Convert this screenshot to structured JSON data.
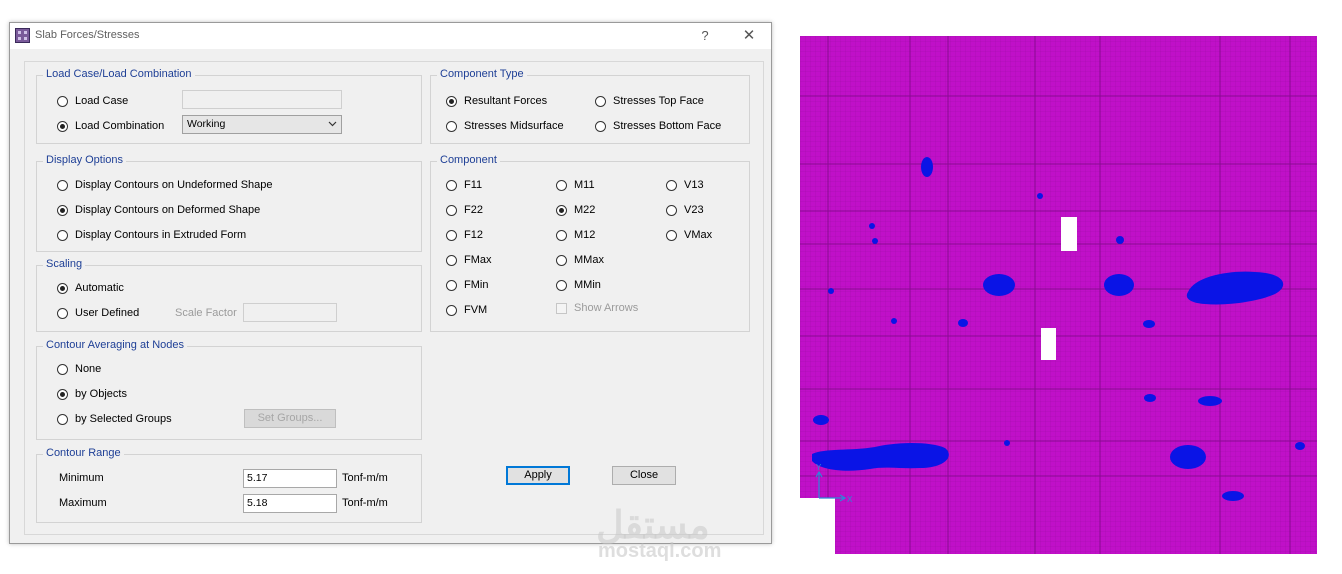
{
  "window": {
    "title": "Slab Forces/Stresses",
    "help": "?",
    "close": "✕"
  },
  "load_case_group": {
    "legend": "Load Case/Load Combination",
    "load_case_label": "Load Case",
    "load_case_value": "",
    "load_combination_label": "Load Combination",
    "load_combination_value": "Working",
    "selected": "Load Combination"
  },
  "display_options": {
    "legend": "Display Options",
    "options": [
      "Display Contours on Undeformed Shape",
      "Display Contours on Deformed Shape",
      "Display Contours in Extruded Form"
    ],
    "selected": "Display Contours on Deformed Shape"
  },
  "scaling": {
    "legend": "Scaling",
    "automatic_label": "Automatic",
    "user_defined_label": "User Defined",
    "scale_factor_label": "Scale Factor",
    "scale_factor_value": "",
    "selected": "Automatic"
  },
  "contour_averaging": {
    "legend": "Contour Averaging at Nodes",
    "options": [
      "None",
      "by Objects",
      "by Selected Groups"
    ],
    "selected": "by Objects",
    "set_groups_label": "Set Groups..."
  },
  "contour_range": {
    "legend": "Contour Range",
    "minimum_label": "Minimum",
    "minimum_value": "5.17",
    "maximum_label": "Maximum",
    "maximum_value": "5.18",
    "units": "Tonf-m/m"
  },
  "component_type": {
    "legend": "Component Type",
    "options": [
      "Resultant Forces",
      "Stresses Top Face",
      "Stresses Midsurface",
      "Stresses Bottom Face"
    ],
    "selected": "Resultant Forces"
  },
  "component": {
    "legend": "Component",
    "col1": [
      "F11",
      "F22",
      "F12",
      "FMax",
      "FMin",
      "FVM"
    ],
    "col2": [
      "M11",
      "M22",
      "M12",
      "MMax",
      "MMin"
    ],
    "col3": [
      "V13",
      "V23",
      "VMax"
    ],
    "selected": "M22",
    "show_arrows_label": "Show Arrows"
  },
  "buttons": {
    "apply": "Apply",
    "close": "Close"
  },
  "plot": {
    "background_color": "#c010c8",
    "contour_color": "#0a14e6",
    "axis_x": "X",
    "axis_y": "Y"
  },
  "watermark": {
    "arabic": "مستقل",
    "latin": "mostaql.com"
  }
}
